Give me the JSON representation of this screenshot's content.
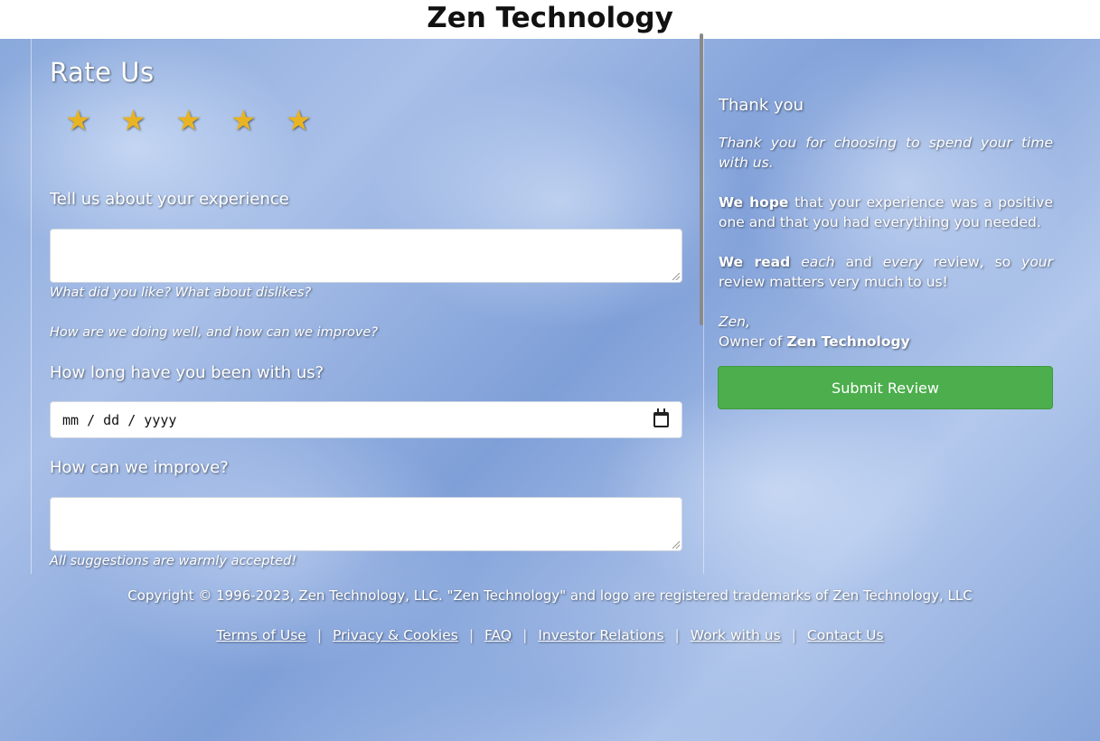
{
  "header": {
    "title": "Zen Technology"
  },
  "rating": {
    "title": "Rate Us",
    "stars": [
      "★",
      "★",
      "★",
      "★",
      "★"
    ]
  },
  "form": {
    "experience_label": "Tell us about your experience",
    "experience_hint_1": "What did you like? What about dislikes?",
    "experience_hint_2": "How are we doing well, and how can we improve?",
    "duration_label": "How long have you been with us?",
    "date_placeholder": "mm / dd / yyyy",
    "improve_label": "How can we improve?",
    "improve_hint": "All suggestions are warmly accepted!"
  },
  "sidebar": {
    "title": "Thank you",
    "p1": "Thank you for choosing to spend your time with us.",
    "p2_bold": "We hope",
    "p2_rest": " that your experience was a positive one and that you had everything you needed.",
    "p3_bold": "We read",
    "p3_each": "each",
    "p3_and": " and ",
    "p3_every": "every",
    "p3_mid": " review, so ",
    "p3_your": "your",
    "p3_end": " review matters very much to us!",
    "sign_name": "Zen,",
    "sign_owner_prefix": "Owner of ",
    "sign_company": "Zen Technology",
    "submit_label": "Submit Review"
  },
  "footer": {
    "copyright": "Copyright © 1996-2023, Zen Technology, LLC. \"Zen Technology\" and logo are registered trademarks of Zen Technology, LLC",
    "links": [
      "Terms of Use",
      "Privacy & Cookies",
      "FAQ",
      "Investor Relations",
      "Work with us",
      "Contact Us"
    ],
    "separator": "|"
  }
}
